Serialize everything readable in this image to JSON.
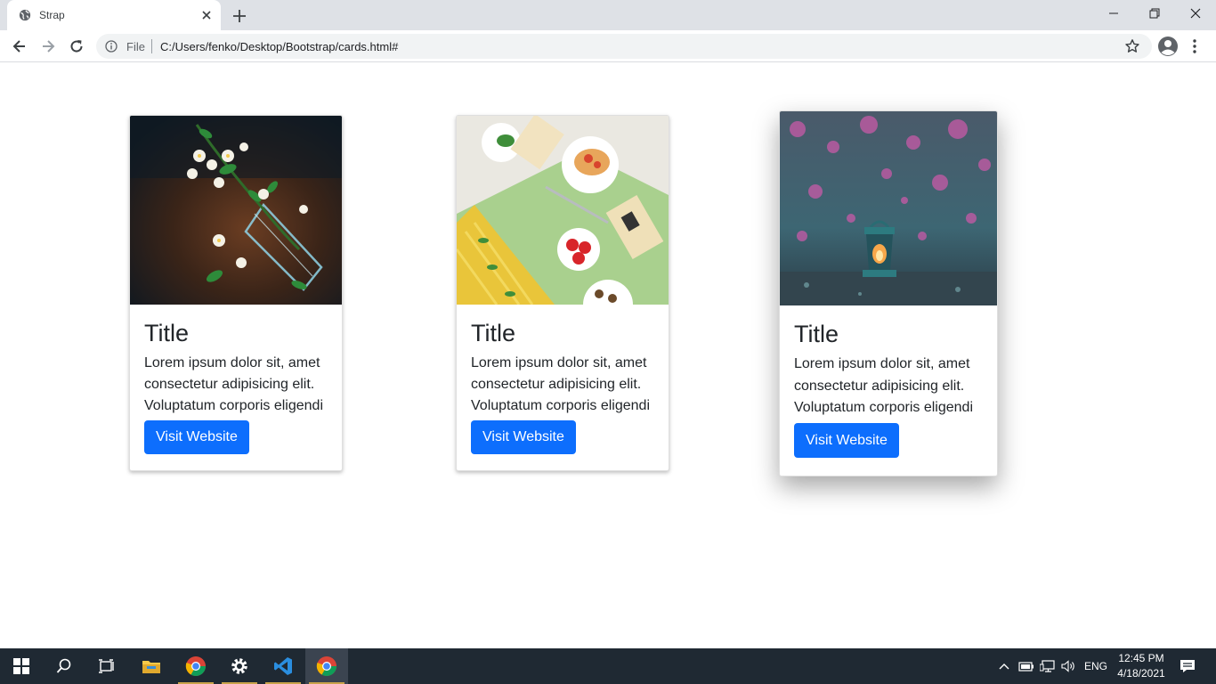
{
  "browser": {
    "tab_title": "Strap",
    "omnibox": {
      "scheme_label": "File",
      "url": "C:/Users/fenko/Desktop/Bootstrap/cards.html#"
    },
    "icons": [
      "globe-icon",
      "close-icon",
      "plus-icon",
      "minimize-icon",
      "restore-icon",
      "close-window-icon",
      "back-icon",
      "forward-icon",
      "reload-icon",
      "info-icon",
      "star-icon",
      "profile-icon",
      "more-icon"
    ]
  },
  "cards": [
    {
      "title": "Title",
      "text": "Lorem ipsum dolor sit, amet consectetur adipisicing elit. Voluptatum corporis eligendi",
      "button_label": "Visit Website",
      "image": "jasmine-flowers-glass-photo"
    },
    {
      "title": "Title",
      "text": "Lorem ipsum dolor sit, amet consectetur adipisicing elit. Voluptatum corporis eligendi",
      "button_label": "Visit Website",
      "image": "pasta-tomatoes-flatlay-photo"
    },
    {
      "title": "Title",
      "text": "Lorem ipsum dolor sit, amet consectetur adipisicing elit. Voluptatum corporis eligendi",
      "button_label": "Visit Website",
      "image": "lantern-pink-blossoms-photo"
    }
  ],
  "taskbar": {
    "apps": [
      "windows-start-icon",
      "search-icon",
      "task-view-icon",
      "file-explorer-icon",
      "chrome-icon",
      "settings-icon",
      "vscode-icon",
      "chrome-icon"
    ],
    "tray": {
      "language": "ENG",
      "time": "12:45 PM",
      "date": "4/18/2021"
    }
  },
  "colors": {
    "button_primary": "#0d6efd",
    "tabstrip": "#dee1e6",
    "taskbar": "#1f2933"
  }
}
